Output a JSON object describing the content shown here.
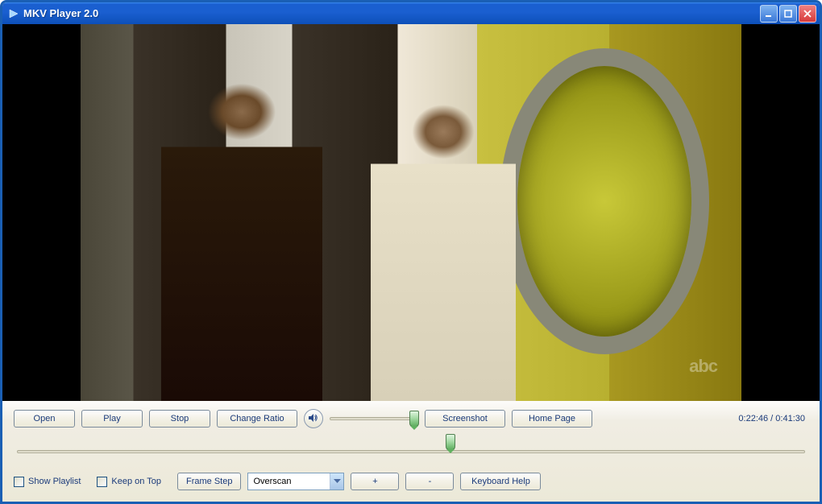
{
  "window": {
    "title": "MKV Player 2.0"
  },
  "video": {
    "watermark": "abc"
  },
  "controls": {
    "open": "Open",
    "play": "Play",
    "stop": "Stop",
    "change_ratio": "Change Ratio",
    "screenshot": "Screenshot",
    "home_page": "Home Page",
    "frame_step": "Frame Step",
    "zoom_in": "+",
    "zoom_out": "-",
    "keyboard_help": "Keyboard Help"
  },
  "checkboxes": {
    "show_playlist": "Show Playlist",
    "keep_on_top": "Keep on Top"
  },
  "dropdown": {
    "overscan_selected": "Overscan"
  },
  "time": {
    "current": "0:22:46",
    "separator": " / ",
    "total": "0:41:30"
  },
  "sliders": {
    "volume_percent": 95,
    "seek_percent": 55
  }
}
